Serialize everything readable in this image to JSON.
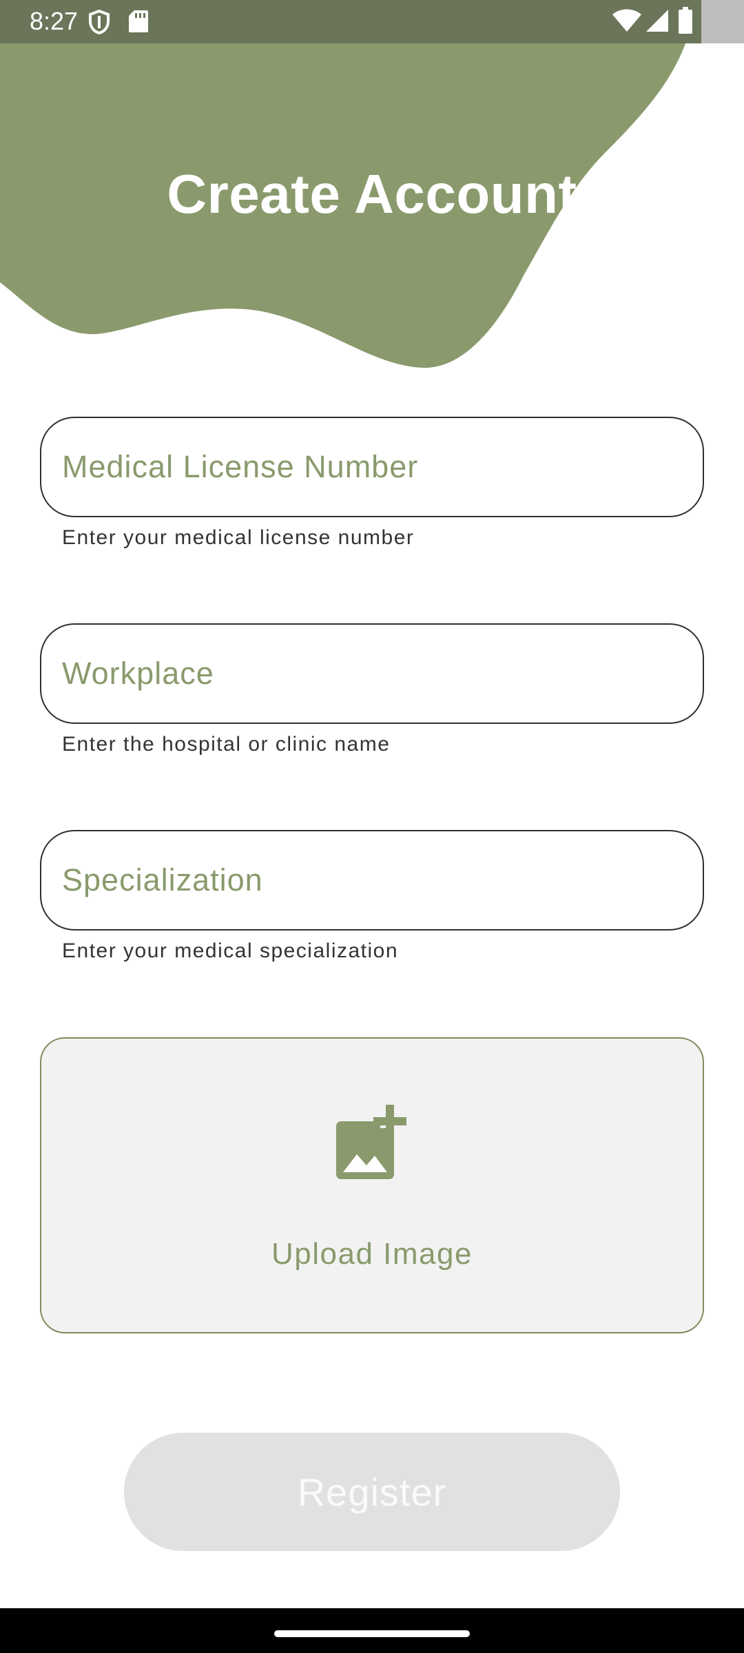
{
  "status_bar": {
    "time": "8:27",
    "left_icons": [
      "shield-icon",
      "sd-card-icon"
    ],
    "right_icons": [
      "wifi-icon",
      "cell-signal-icon",
      "battery-icon"
    ]
  },
  "header": {
    "title": "Create Account",
    "accent_color": "#8a9a6c"
  },
  "form": {
    "fields": [
      {
        "placeholder": "Medical License Number",
        "helper": "Enter your medical license number"
      },
      {
        "placeholder": "Workplace",
        "helper": "Enter the hospital or clinic name"
      },
      {
        "placeholder": "Specialization",
        "helper": "Enter your medical specialization"
      }
    ],
    "upload": {
      "label": "Upload Image",
      "icon": "add-photo-icon"
    },
    "register_label": "Register"
  },
  "colors": {
    "primary": "#8a9a6c",
    "status_bar": "#6b7559",
    "button_disabled": "#e1e1e1"
  }
}
